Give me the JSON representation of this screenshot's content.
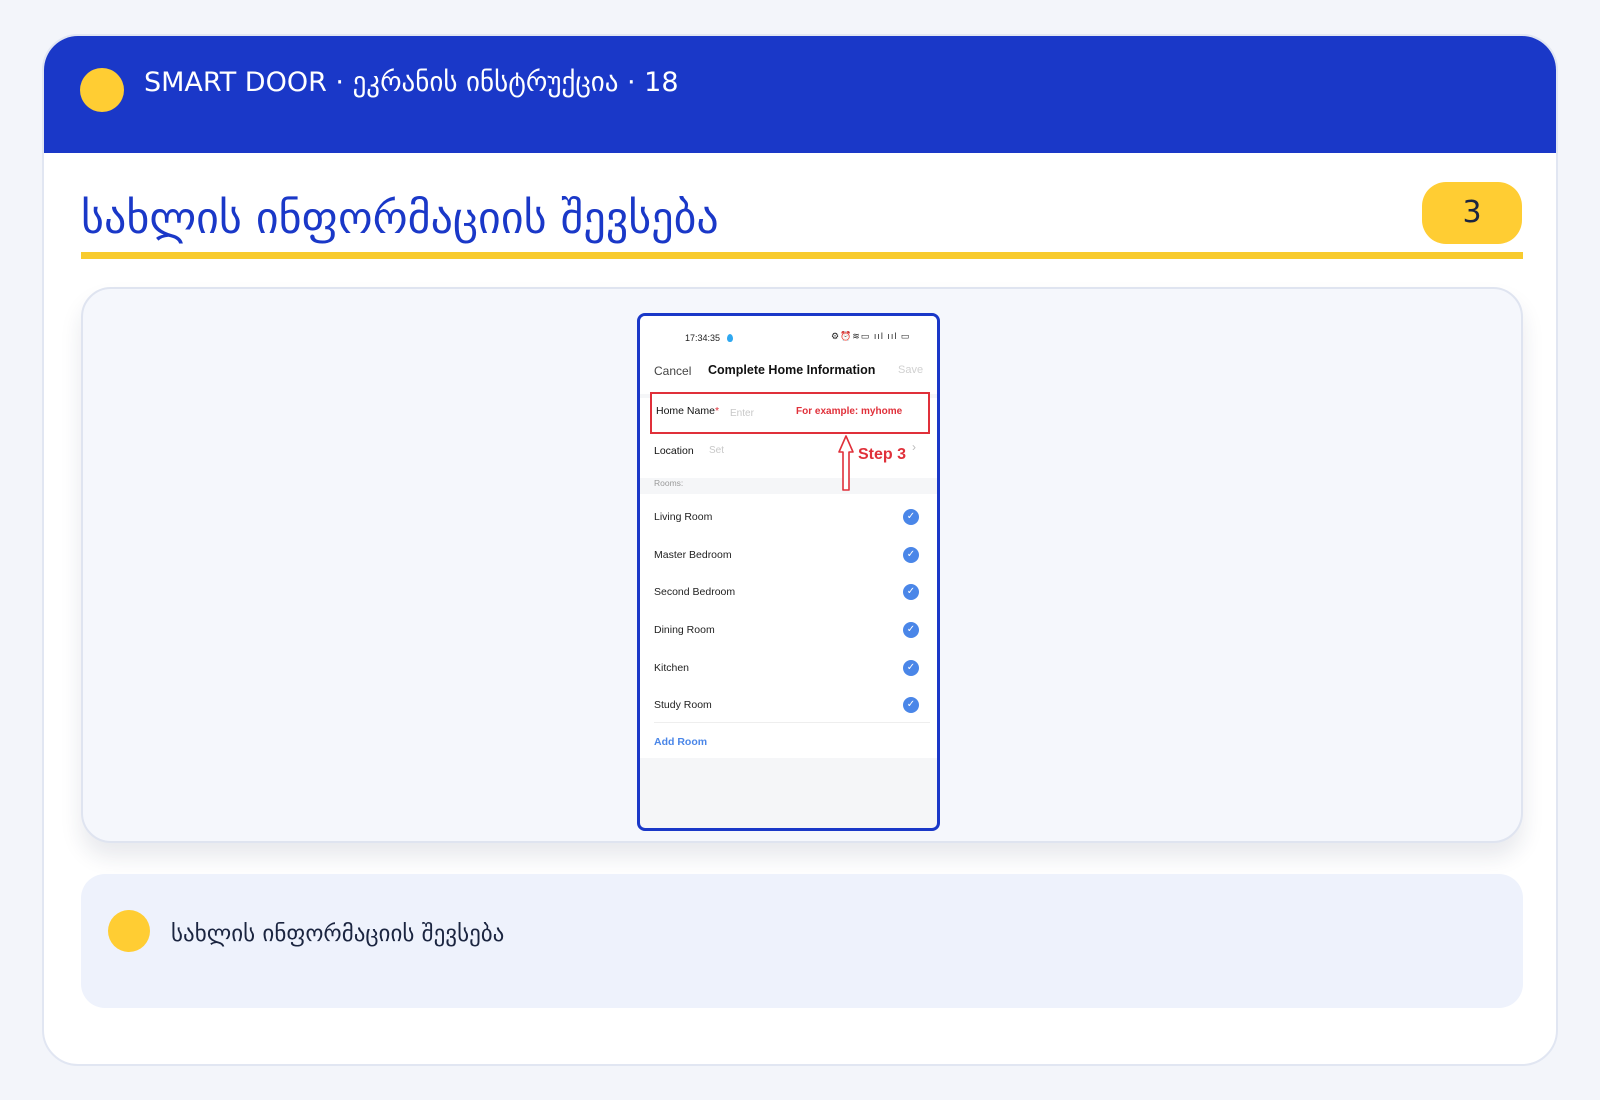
{
  "header": {
    "title": "SMART DOOR · ეკრანის ინსტრუქცია · 18"
  },
  "page": {
    "title": "სახლის ინფორმაციის შევსება",
    "step_number": "3"
  },
  "phone": {
    "status": {
      "time": "17:34:35",
      "icons": "⚙⏰≋▭ ııl ııl ▭"
    },
    "nav": {
      "cancel": "Cancel",
      "title": "Complete Home Information",
      "save": "Save"
    },
    "form": {
      "home_name_label": "Home Name",
      "required_mark": "*",
      "home_name_placeholder": "Enter",
      "example": "For example:  myhome",
      "location_label": "Location",
      "location_value": "Set",
      "chevron": "›"
    },
    "annotation": {
      "step_label": "Step 3"
    },
    "rooms_header": "Rooms:",
    "rooms": [
      {
        "label": "Living Room",
        "checked": true
      },
      {
        "label": "Master Bedroom",
        "checked": true
      },
      {
        "label": "Second Bedroom",
        "checked": true
      },
      {
        "label": "Dining Room",
        "checked": true
      },
      {
        "label": "Kitchen",
        "checked": true
      },
      {
        "label": "Study Room",
        "checked": true
      }
    ],
    "check_glyph": "✓",
    "add_room": "Add Room"
  },
  "note": {
    "text": "სახლის ინფორმაციის შევსება"
  },
  "colors": {
    "brand_blue": "#1a38c8",
    "accent_yellow": "#ffcd33",
    "highlight_red": "#e0303a",
    "link_blue": "#4a86e8"
  }
}
